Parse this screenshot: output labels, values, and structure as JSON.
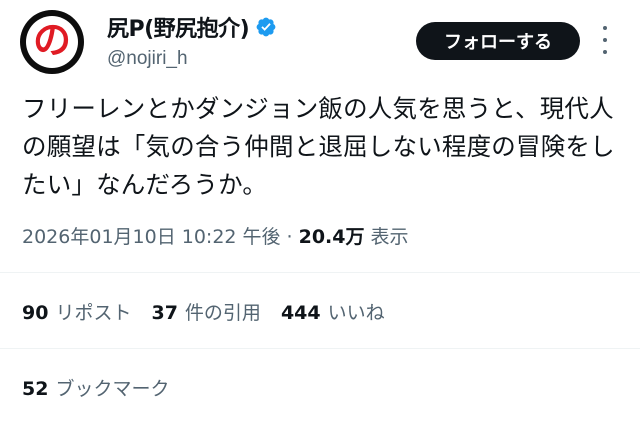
{
  "author": {
    "display_name": "尻P(野尻抱介)",
    "handle": "@nojiri_h",
    "avatar_mark": "の",
    "verified": true
  },
  "header": {
    "follow_label": "フォローする",
    "more_icon": "more-vertical-icon"
  },
  "tweet": {
    "text": "フリーレンとかダンジョン飯の人気を思うと、現代人の願望は「気の合う仲間と退屈しない程度の冒険をしたい」なんだろうか。",
    "timestamp": "2026年01月10日 10:22 午後",
    "separator": "·",
    "views_count": "20.4万",
    "views_label": "表示"
  },
  "stats": {
    "reposts": {
      "count": "90",
      "label": "リポスト"
    },
    "quotes": {
      "count": "37",
      "label": "件の引用"
    },
    "likes": {
      "count": "444",
      "label": "いいね"
    },
    "bookmarks": {
      "count": "52",
      "label": "ブックマーク"
    }
  },
  "colors": {
    "text": "#0f1419",
    "secondary": "#536471",
    "verified": "#1d9bf0",
    "button_bg": "#0f1419",
    "divider": "#eff3f4",
    "avatar_mark": "#e01b24"
  }
}
